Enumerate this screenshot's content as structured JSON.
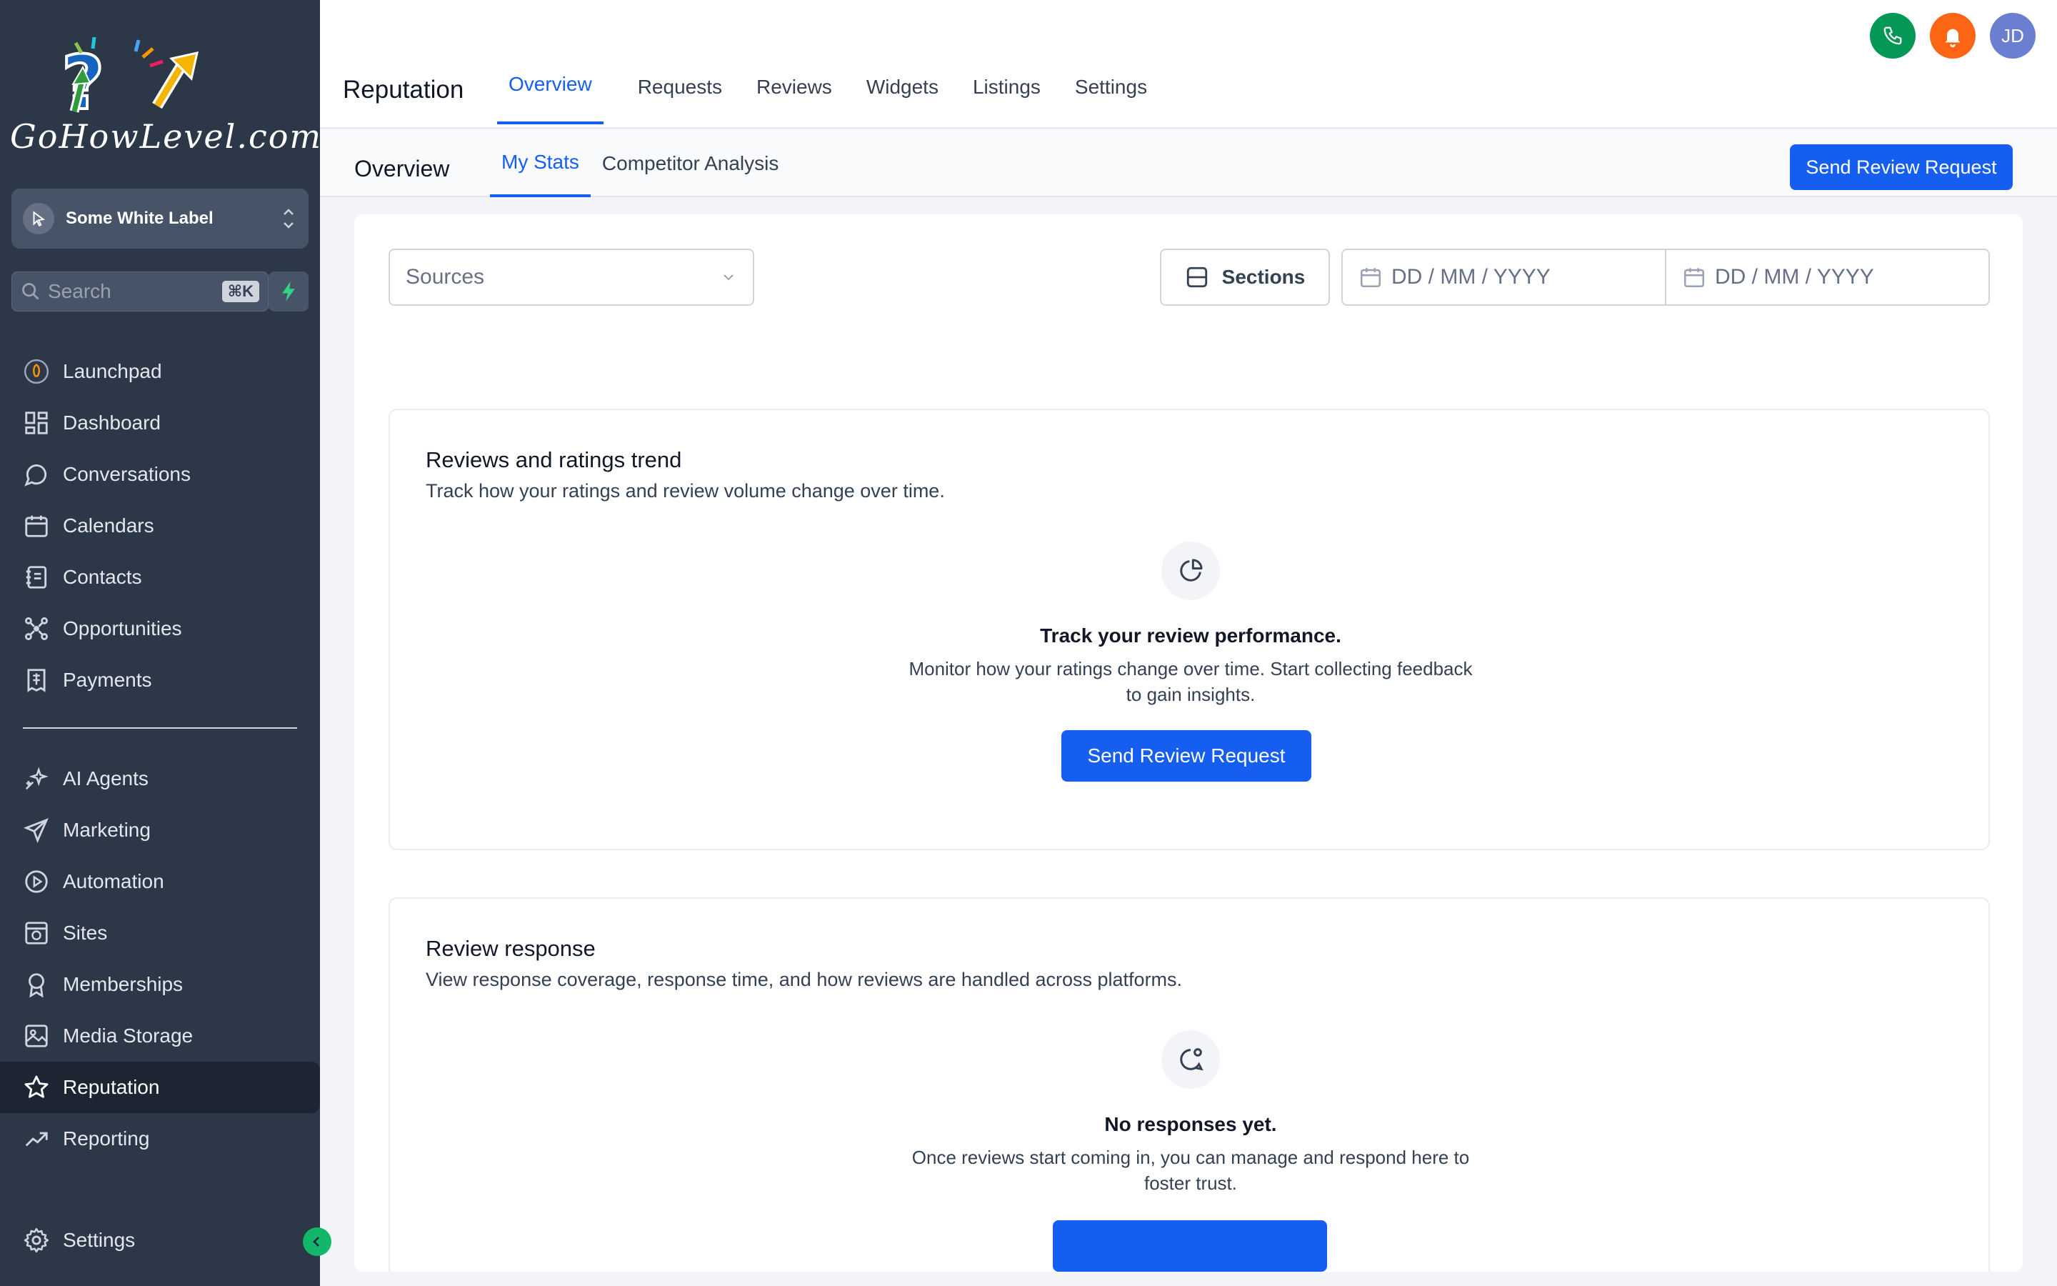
{
  "brand": {
    "logo_text": "GoHowLevel.com"
  },
  "workspace": {
    "name": "Some White Label"
  },
  "search": {
    "placeholder": "Search",
    "shortcut": "⌘K"
  },
  "sidebar": {
    "items": [
      {
        "label": "Launchpad",
        "icon": "rocket-icon"
      },
      {
        "label": "Dashboard",
        "icon": "grid-icon"
      },
      {
        "label": "Conversations",
        "icon": "chat-bubble-icon"
      },
      {
        "label": "Calendars",
        "icon": "calendar-icon"
      },
      {
        "label": "Contacts",
        "icon": "contact-book-icon"
      },
      {
        "label": "Opportunities",
        "icon": "network-icon"
      },
      {
        "label": "Payments",
        "icon": "receipt-icon"
      }
    ],
    "items2": [
      {
        "label": "AI Agents",
        "icon": "sparkle-icon"
      },
      {
        "label": "Marketing",
        "icon": "send-icon"
      },
      {
        "label": "Automation",
        "icon": "play-circle-icon"
      },
      {
        "label": "Sites",
        "icon": "browser-icon"
      },
      {
        "label": "Memberships",
        "icon": "badge-icon"
      },
      {
        "label": "Media Storage",
        "icon": "image-icon"
      },
      {
        "label": "Reputation",
        "icon": "star-icon",
        "active": true
      },
      {
        "label": "Reporting",
        "icon": "trend-icon"
      }
    ],
    "settings_label": "Settings"
  },
  "header": {
    "title": "Reputation",
    "tabs": [
      "Overview",
      "Requests",
      "Reviews",
      "Widgets",
      "Listings",
      "Settings"
    ],
    "active_tab": "Overview",
    "user_initials": "JD"
  },
  "subheader": {
    "title": "Overview",
    "tabs": [
      "My Stats",
      "Competitor Analysis"
    ],
    "active_tab": "My Stats",
    "action_label": "Send Review Request"
  },
  "filters": {
    "sources_placeholder": "Sources",
    "sections_label": "Sections",
    "start_date_placeholder": "DD / MM / YYYY",
    "end_date_placeholder": "DD / MM / YYYY"
  },
  "panels": {
    "trend": {
      "title": "Reviews and ratings trend",
      "description": "Track how your ratings and review volume change over time.",
      "empty_title": "Track your review performance.",
      "empty_text": "Monitor how your ratings change over time. Start collecting feedback to gain insights.",
      "button_label": "Send Review Request"
    },
    "response": {
      "title": "Review response",
      "description": "View response coverage, response time, and how reviews are handled across platforms.",
      "empty_title": "No responses yet.",
      "empty_text": "Once reviews start coming in, you can manage and respond here to foster trust."
    }
  },
  "colors": {
    "sidebar_bg": "#2c3748",
    "accent": "#155eef",
    "phone": "#039855",
    "bell": "#fb6514",
    "avatar": "#6b7fd1"
  }
}
